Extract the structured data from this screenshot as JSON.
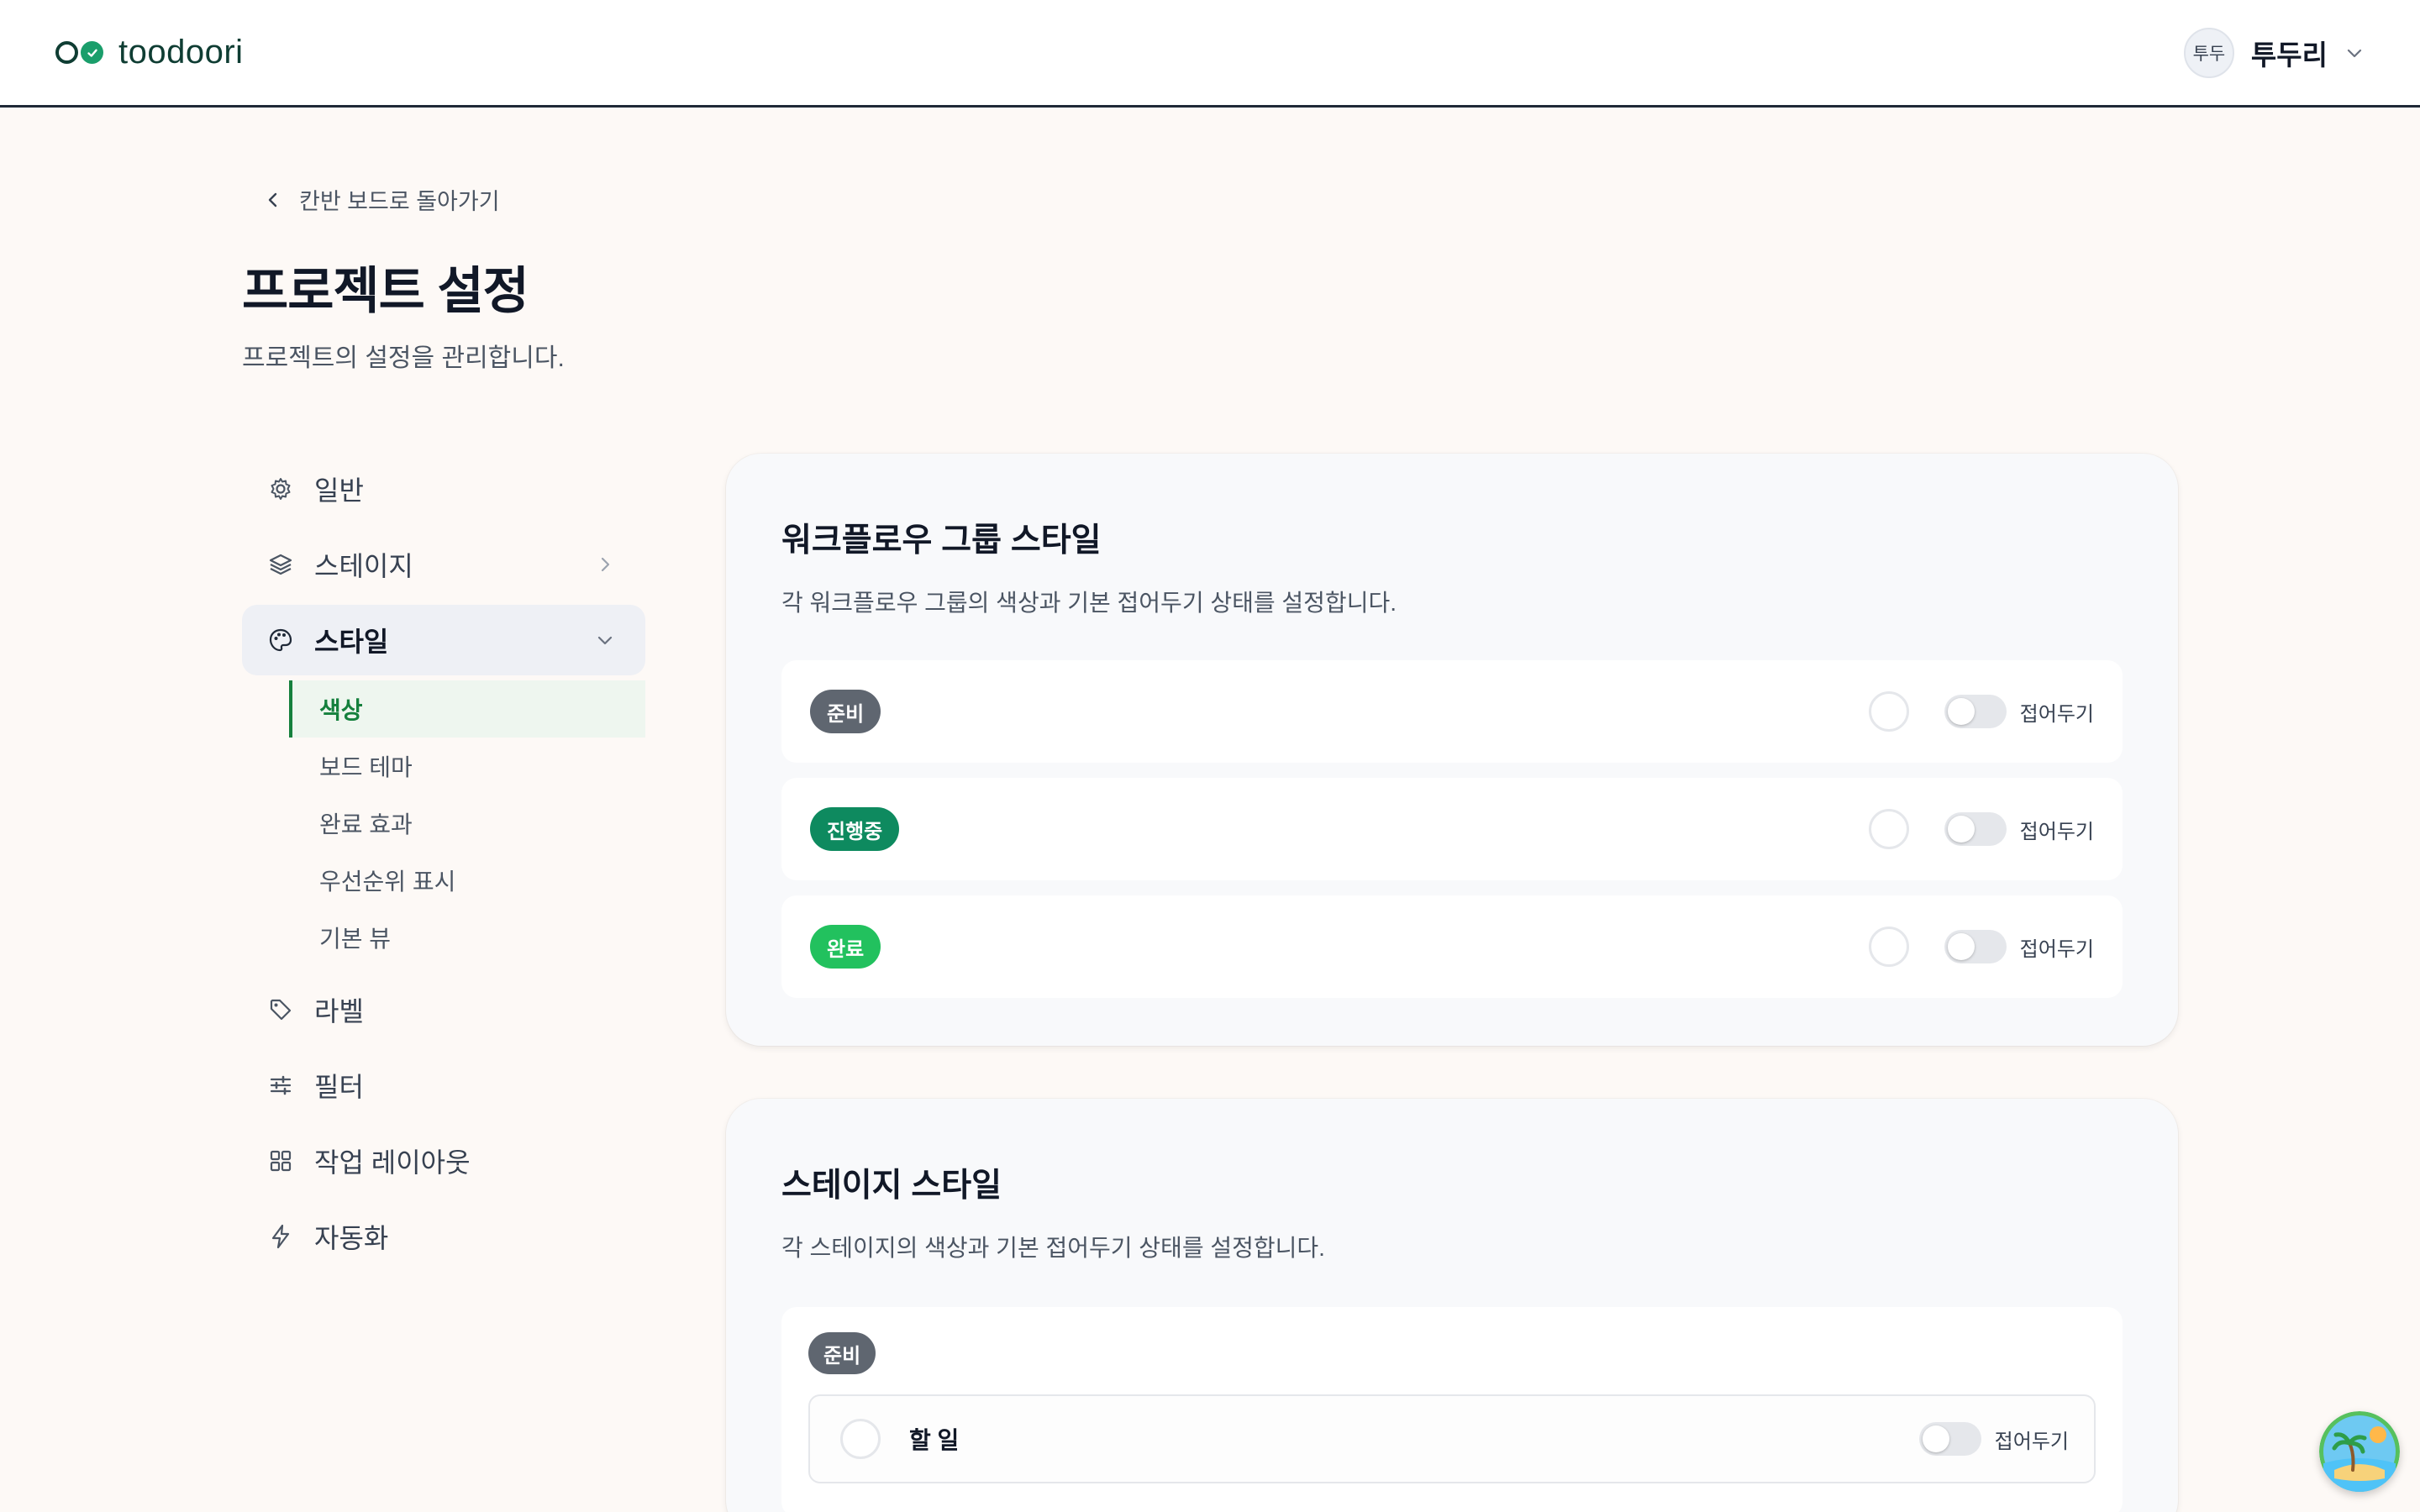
{
  "header": {
    "brand": "toodoori",
    "user_initials": "투두",
    "user_name": "투두리"
  },
  "page": {
    "back_label": "칸반 보드로 돌아가기",
    "title": "프로젝트 설정",
    "description": "프로젝트의 설정을 관리합니다."
  },
  "sidebar": {
    "items": [
      {
        "label": "일반",
        "icon": "gear-icon"
      },
      {
        "label": "스테이지",
        "icon": "layers-icon"
      },
      {
        "label": "스타일",
        "icon": "palette-icon"
      },
      {
        "label": "라벨",
        "icon": "tag-icon"
      },
      {
        "label": "필터",
        "icon": "sliders-icon"
      },
      {
        "label": "작업 레이아웃",
        "icon": "grid-icon"
      },
      {
        "label": "자동화",
        "icon": "bolt-icon"
      }
    ],
    "style_subitems": [
      "색상",
      "보드 테마",
      "완료 효과",
      "우선순위 표시",
      "기본 뷰"
    ],
    "active_subitem": "색상"
  },
  "workflow_card": {
    "title": "워크플로우 그룹 스타일",
    "description": "각 워크플로우 그룹의 색상과 기본 접어두기 상태를 설정합니다.",
    "groups": [
      {
        "label": "준비",
        "color": "#5f6670",
        "collapse_label": "접어두기",
        "collapsed": false
      },
      {
        "label": "진행중",
        "color": "#0e8a5f",
        "collapse_label": "접어두기",
        "collapsed": false
      },
      {
        "label": "완료",
        "color": "#22c15e",
        "collapse_label": "접어두기",
        "collapsed": false
      }
    ]
  },
  "stage_card": {
    "title": "스테이지 스타일",
    "description": "각 스테이지의 색상과 기본 접어두기 상태를 설정합니다.",
    "group_label": "준비",
    "group_color": "#5f6670",
    "stage_name": "할 일",
    "collapse_label": "접어두기"
  },
  "colors": {
    "accent_green": "#15803d",
    "background": "#fdf9f6",
    "card": "#f8f9fb"
  }
}
